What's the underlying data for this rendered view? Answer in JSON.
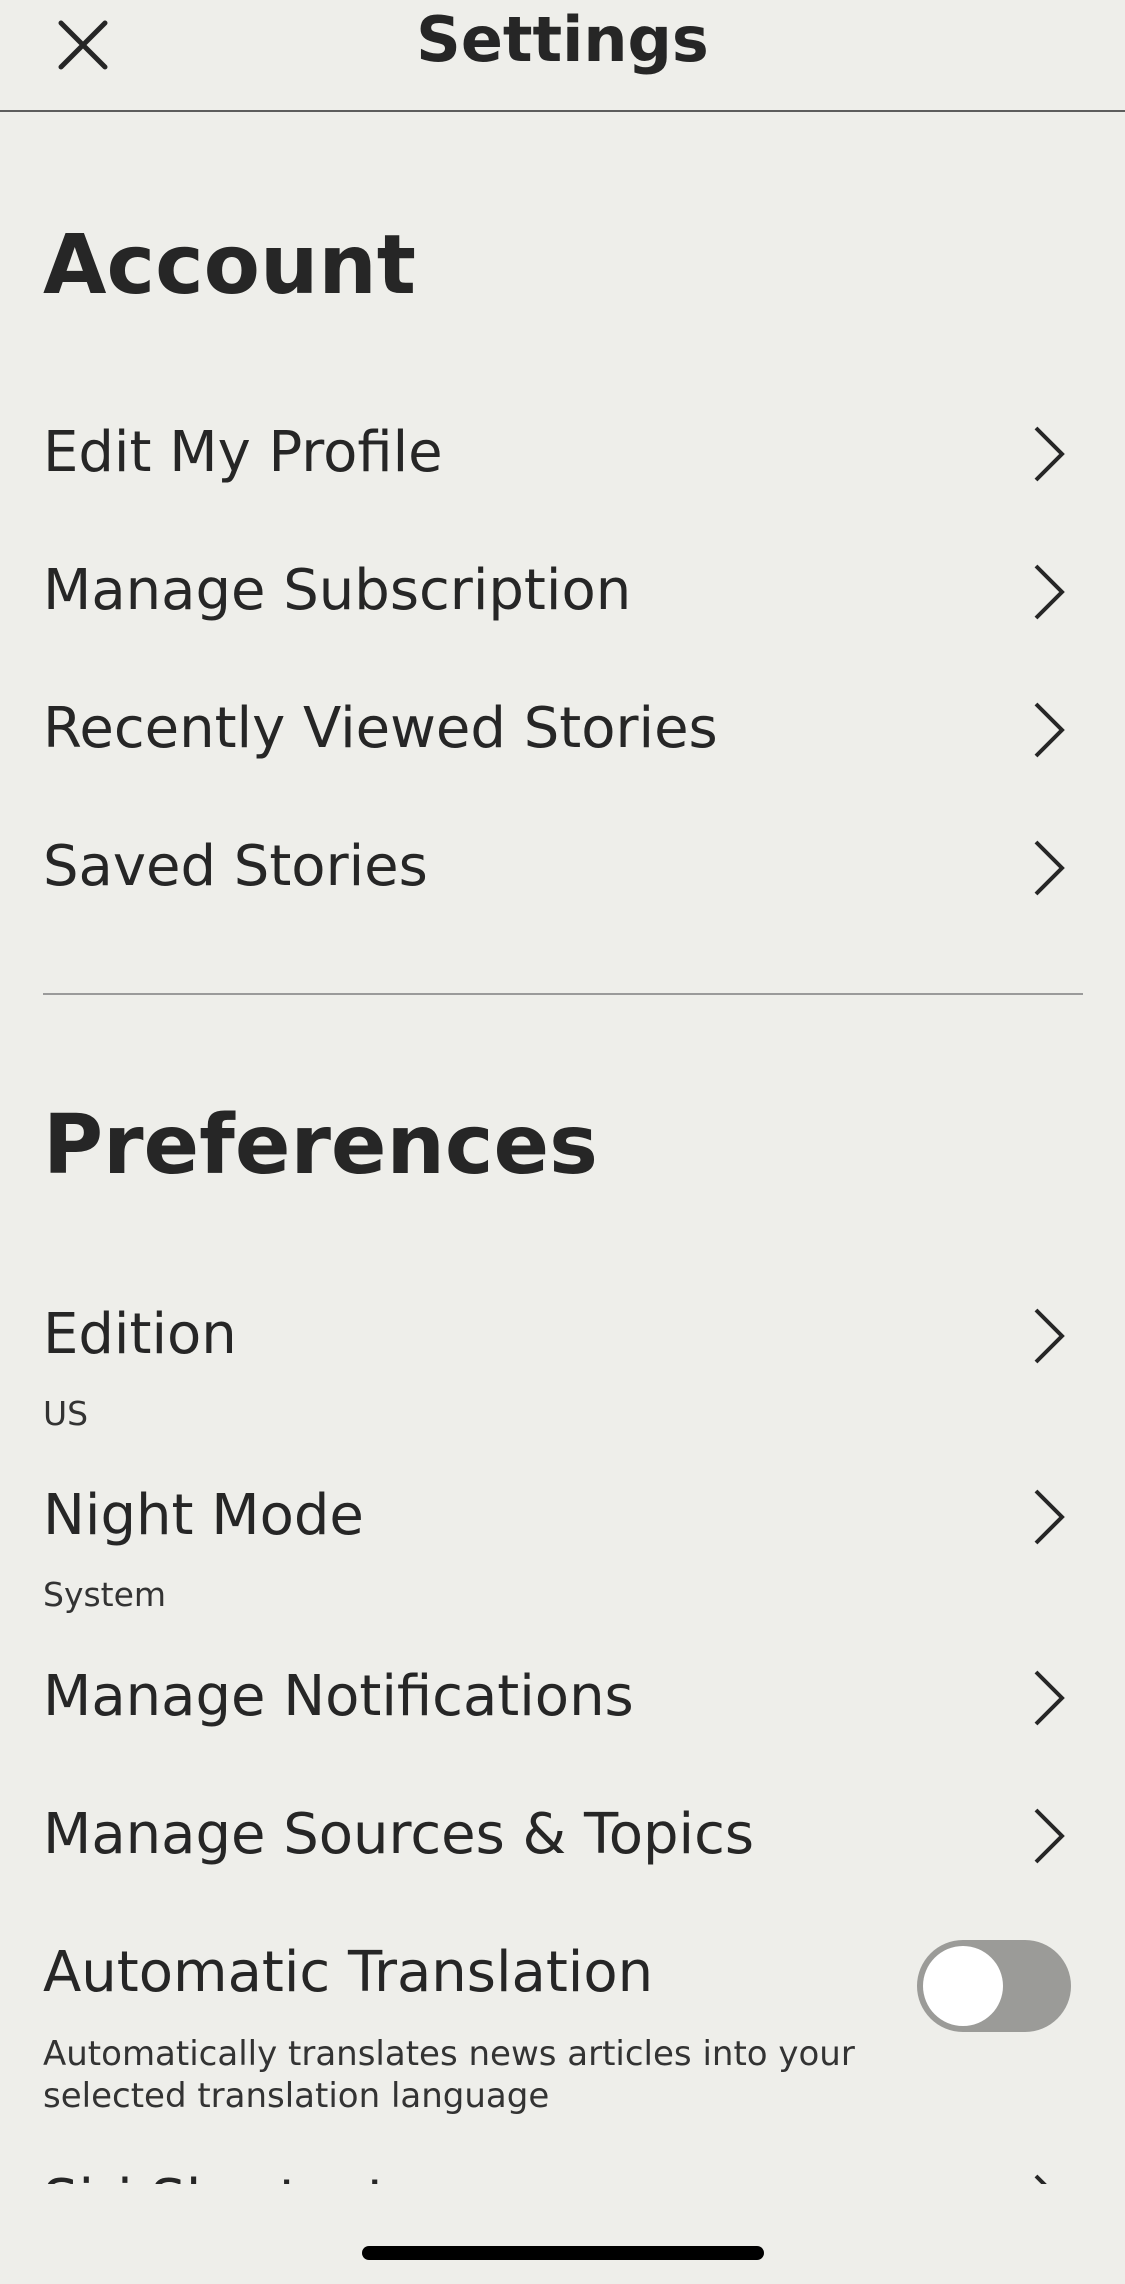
{
  "header": {
    "title": "Settings",
    "close_icon": "close-icon"
  },
  "account": {
    "title": "Account",
    "items": [
      {
        "label": "Edit My Profile"
      },
      {
        "label": "Manage Subscription"
      },
      {
        "label": "Recently Viewed Stories"
      },
      {
        "label": "Saved Stories"
      }
    ]
  },
  "preferences": {
    "title": "Preferences",
    "edition": {
      "label": "Edition",
      "value": "US"
    },
    "night_mode": {
      "label": "Night Mode",
      "value": "System"
    },
    "notifications": {
      "label": "Manage Notifications"
    },
    "sources": {
      "label": "Manage Sources & Topics"
    },
    "translation": {
      "label": "Automatic Translation",
      "enabled": false,
      "description": "Automatically translates news articles into your selected translation language"
    },
    "next_item": {
      "label": "Siri Shortcuts"
    }
  },
  "colors": {
    "background": "#eeeeea",
    "text": "#262626",
    "toggle_off": "#9b9b98"
  }
}
